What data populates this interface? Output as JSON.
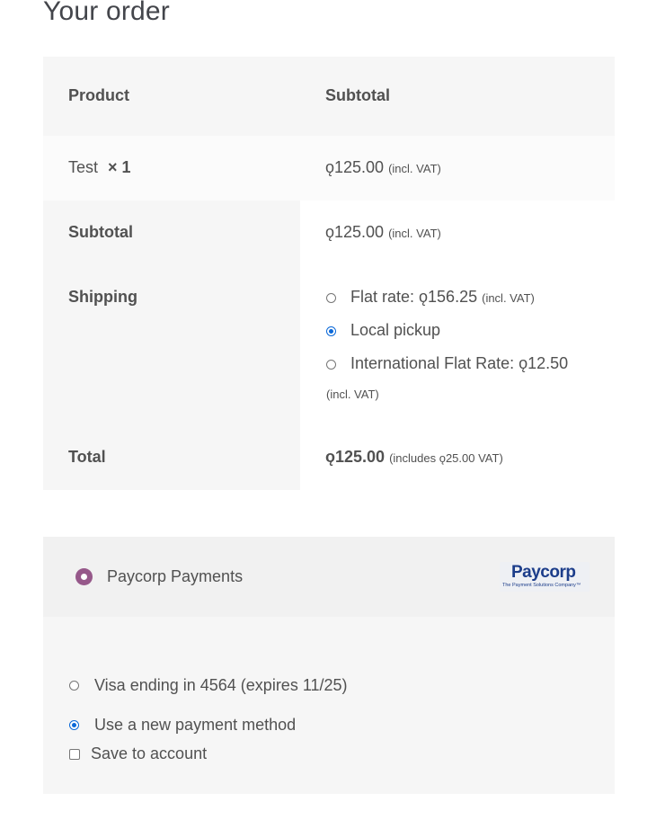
{
  "title": "Your order",
  "table": {
    "headers": {
      "product": "Product",
      "subtotal": "Subtotal"
    },
    "item": {
      "name": "Test",
      "qty": "× 1",
      "price": "ǫ125.00",
      "tax_note": "(incl. VAT)"
    },
    "subtotal": {
      "label": "Subtotal",
      "value": "ǫ125.00",
      "tax_note": "(incl. VAT)"
    },
    "shipping": {
      "label": "Shipping",
      "options": [
        {
          "label": "Flat rate: ǫ156.25",
          "tax_note": "(incl. VAT)",
          "selected": false
        },
        {
          "label": "Local pickup",
          "tax_note": "",
          "selected": true
        },
        {
          "label": "International Flat Rate: ǫ12.50",
          "tax_note": "(incl. VAT)",
          "selected": false
        }
      ]
    },
    "total": {
      "label": "Total",
      "value": "ǫ125.00",
      "tax_note": "(includes ǫ25.00 VAT)"
    }
  },
  "payment": {
    "method_label": "Paycorp Payments",
    "method_selected": true,
    "logo_text": "Paycorp",
    "logo_tagline": "The Payment Solutions Company™",
    "saved_card": {
      "label": "Visa ending in 4564 (expires 11/25)",
      "selected": false
    },
    "new_method": {
      "label": "Use a new payment method",
      "selected": true
    },
    "save_to_account": {
      "label": "Save to account",
      "checked": false
    }
  },
  "colors": {
    "accent": "#96588a",
    "radio_checked": "#0a68d8",
    "row_alt": "#f8f8f8",
    "header_bg": "#f6f6f6"
  }
}
